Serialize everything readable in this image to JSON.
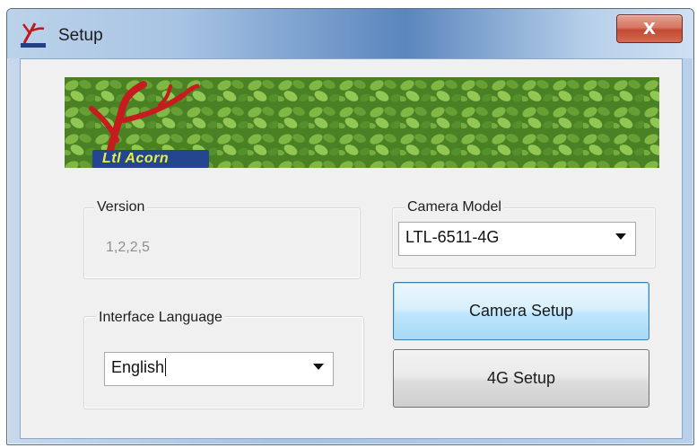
{
  "window": {
    "title": "Setup",
    "close_label": "X",
    "icon": "ltl-acorn-logo-icon"
  },
  "banner": {
    "brand_text": "Ltl Acorn"
  },
  "version_group": {
    "label": "Version",
    "value": "1,2,2,5"
  },
  "camera_model_group": {
    "label": "Camera Model",
    "selected": "LTL-6511-4G"
  },
  "language_group": {
    "label": "Interface Language",
    "selected": "English"
  },
  "buttons": {
    "camera_setup": "Camera Setup",
    "setup_4g": "4G Setup"
  },
  "colors": {
    "accent_focus": "#3c7fb1",
    "close_red": "#c24a33",
    "client_bg": "#f0f0f0"
  }
}
